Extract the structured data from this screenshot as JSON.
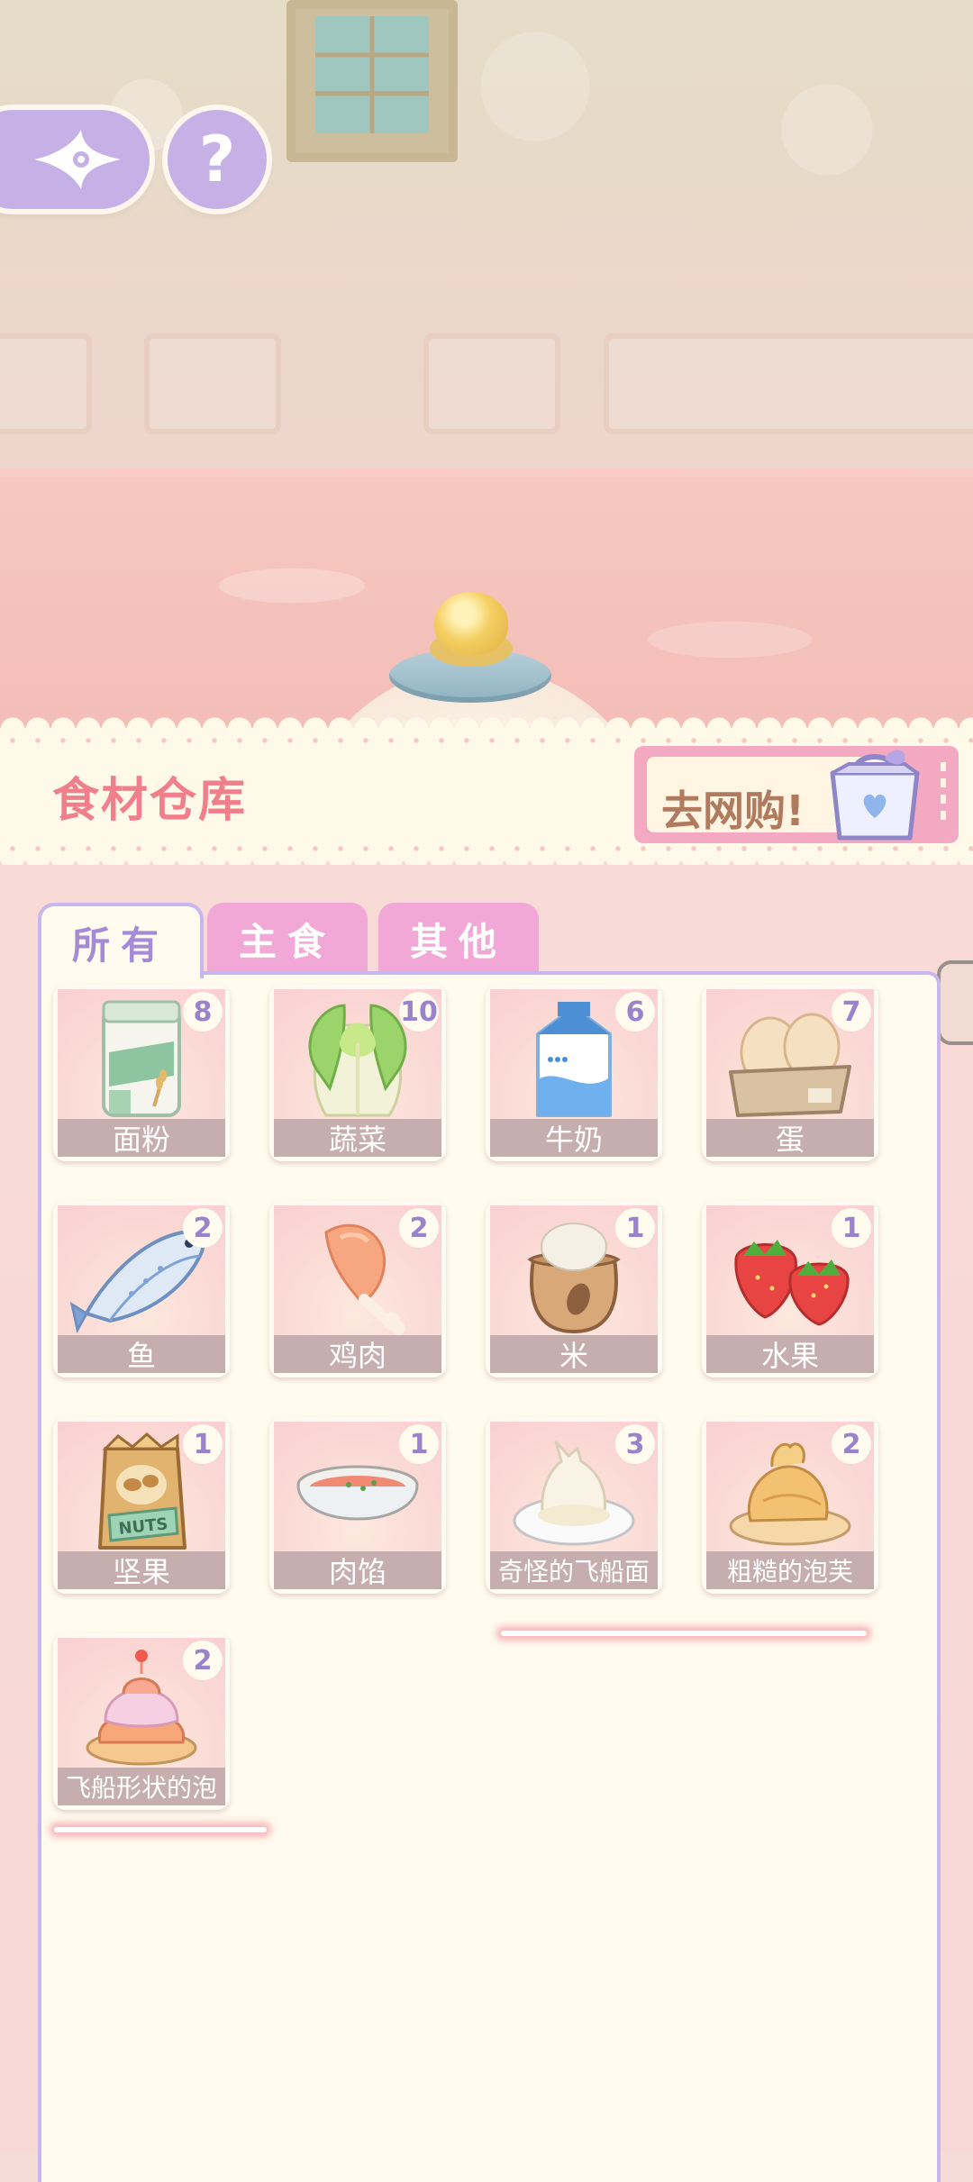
{
  "header": {
    "title": "食材仓库",
    "shop_label": "去网购!"
  },
  "controls": {
    "help_glyph": "?"
  },
  "tabs": [
    {
      "label": "所有",
      "active": true
    },
    {
      "label": "主食",
      "active": false
    },
    {
      "label": "其他",
      "active": false
    }
  ],
  "items": [
    {
      "label": "面粉",
      "count": "8",
      "icon": "flour-bag-icon"
    },
    {
      "label": "蔬菜",
      "count": "10",
      "icon": "cabbage-icon"
    },
    {
      "label": "牛奶",
      "count": "6",
      "icon": "milk-carton-icon"
    },
    {
      "label": "蛋",
      "count": "7",
      "icon": "egg-tray-icon"
    },
    {
      "label": "鱼",
      "count": "2",
      "icon": "fish-icon"
    },
    {
      "label": "鸡肉",
      "count": "2",
      "icon": "chicken-leg-icon"
    },
    {
      "label": "米",
      "count": "1",
      "icon": "rice-sack-icon"
    },
    {
      "label": "水果",
      "count": "1",
      "icon": "strawberry-icon"
    },
    {
      "label": "坚果",
      "count": "1",
      "icon": "nuts-bag-icon"
    },
    {
      "label": "肉馅",
      "count": "1",
      "icon": "minced-meat-bowl-icon"
    },
    {
      "label": "奇怪的飞船面",
      "count": "3",
      "icon": "spaceship-noodle-icon"
    },
    {
      "label": "粗糙的泡芙",
      "count": "2",
      "icon": "rough-puff-icon"
    },
    {
      "label": "飞船形状的泡",
      "count": "2",
      "icon": "spaceship-puff-icon"
    }
  ],
  "colors": {
    "accent_purple": "#c6b1e6",
    "title_pink": "#ef7f8b",
    "tab_pink": "#f1a8d6",
    "panel_cream": "#fffbee"
  }
}
